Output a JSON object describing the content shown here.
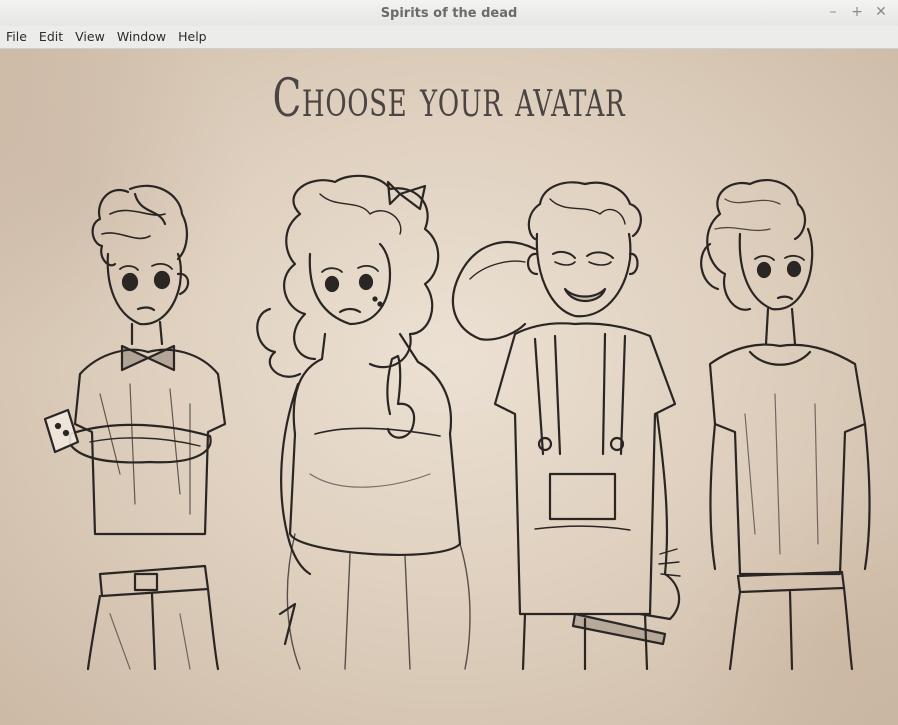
{
  "window": {
    "title": "Spirits of the dead",
    "controls": {
      "minimize_icon": "minimize-icon",
      "maximize_icon": "maximize-icon",
      "close_icon": "close-icon"
    }
  },
  "menubar": {
    "items": [
      {
        "label": "File"
      },
      {
        "label": "Edit"
      },
      {
        "label": "View"
      },
      {
        "label": "Window"
      },
      {
        "label": "Help"
      }
    ]
  },
  "game": {
    "heading": "Choose your avatar",
    "avatars": [
      {
        "id": "boy-with-card"
      },
      {
        "id": "curly-haired-girl"
      },
      {
        "id": "boy-in-overalls"
      },
      {
        "id": "girl-with-bun"
      }
    ],
    "colors": {
      "paper": "#dccbb8",
      "ink": "#2a2624",
      "heading": "#4a4443"
    }
  }
}
